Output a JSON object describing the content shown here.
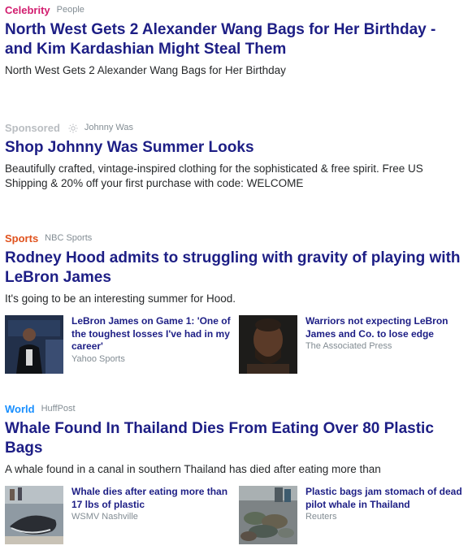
{
  "stories": [
    {
      "category": "Celebrity",
      "category_color": "#d21d6f",
      "source": "People",
      "title": "North West Gets 2 Alexander Wang Bags for Her Birthday - and Kim Kardashian Might Steal Them",
      "summary": "North West Gets 2 Alexander Wang Bags for Her Birthday"
    },
    {
      "category": "Sponsored",
      "category_color": "#b9bdc1",
      "source": "Johnny Was",
      "icon": "sponsor-sun-icon",
      "title": "Shop Johnny Was Summer Looks",
      "summary": "Beautifully crafted, vintage-inspired clothing for the sophisticated & free spirit. Free US Shipping & 20% off your first purchase with code: WELCOME"
    },
    {
      "category": "Sports",
      "category_color": "#e0521d",
      "source": "NBC Sports",
      "title": "Rodney Hood admits to struggling with gravity of playing with LeBron James",
      "summary": "It's going to be an interesting summer for Hood.",
      "related": [
        {
          "title": "LeBron James on Game 1: 'One of the toughest losses I've had in my career'",
          "source": "Yahoo Sports",
          "thumb": "lebron-podium-photo"
        },
        {
          "title": "Warriors not expecting LeBron James and Co. to lose edge",
          "source": "The Associated Press",
          "thumb": "lebron-closeup-photo"
        }
      ]
    },
    {
      "category": "World",
      "category_color": "#188fff",
      "source": "HuffPost",
      "title": "Whale Found In Thailand Dies From Eating Over 80 Plastic Bags",
      "summary": "A whale found in a canal in southern Thailand has died after eating more than",
      "related": [
        {
          "title": "Whale dies after eating more than 17 lbs of plastic",
          "source": "WSMV Nashville",
          "thumb": "whale-on-shore-photo"
        },
        {
          "title": "Plastic bags jam stomach of dead pilot whale in Thailand",
          "source": "Reuters",
          "thumb": "plastic-bags-pile-photo"
        }
      ]
    }
  ]
}
